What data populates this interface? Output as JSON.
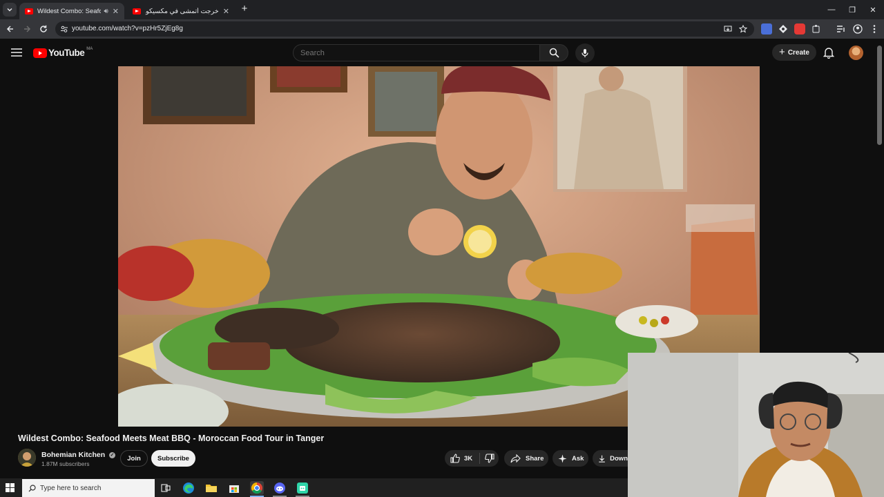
{
  "browser": {
    "tabs": [
      {
        "title": "Wildest Combo: Seafood M",
        "active": true
      },
      {
        "title": "خرجت أتمشى في مكسيكو... وتعرّ",
        "active": false
      }
    ],
    "url": "youtube.com/watch?v=pzHr5ZjEg8g"
  },
  "youtube": {
    "logo_text": "YouTube",
    "country_code": "MA",
    "search_placeholder": "Search",
    "create_label": "Create"
  },
  "video": {
    "title": "Wildest Combo: Seafood Meets Meat BBQ - Moroccan Food Tour in Tanger",
    "channel": "Bohemian Kitchen",
    "subscribers": "1.87M subscribers",
    "join_label": "Join",
    "subscribe_label": "Subscribe",
    "likes": "3K",
    "share_label": "Share",
    "ask_label": "Ask",
    "download_label": "Down"
  },
  "taskbar": {
    "search_placeholder": "Type here to search"
  },
  "colors": {
    "youtube_red": "#ff0000",
    "background": "#0f0f0f",
    "chrome_frame": "#202124"
  }
}
